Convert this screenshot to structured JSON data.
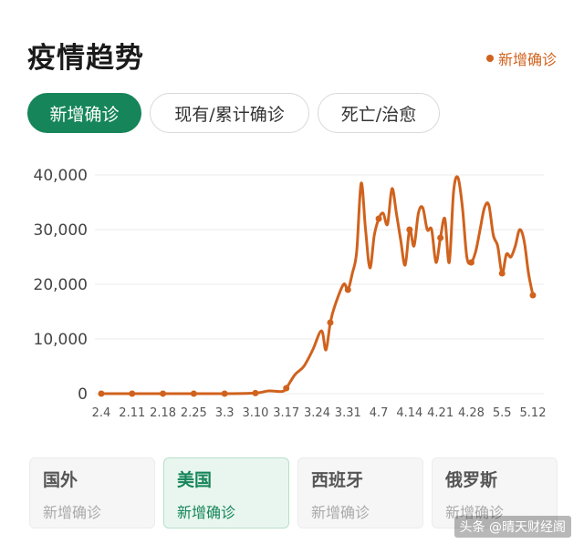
{
  "header": {
    "title": "疫情趋势",
    "legend_label": "新增确诊"
  },
  "tabs": [
    {
      "label": "新增确诊",
      "active": true
    },
    {
      "label": "现有/累计确诊",
      "active": false
    },
    {
      "label": "死亡/治愈",
      "active": false
    }
  ],
  "cards": [
    {
      "name": "国外",
      "sub": "新增确诊",
      "active": false
    },
    {
      "name": "美国",
      "sub": "新增确诊",
      "active": true
    },
    {
      "name": "西班牙",
      "sub": "新增确诊",
      "active": false
    },
    {
      "name": "俄罗斯",
      "sub": "新增确诊",
      "active": false
    }
  ],
  "watermark": "头条 @晴天财经阁",
  "colors": {
    "accent": "#16855a",
    "series": "#d0621d",
    "grid": "#ebebeb"
  },
  "chart_data": {
    "type": "line",
    "title": "",
    "xlabel": "",
    "ylabel": "",
    "ylim": [
      0,
      40000
    ],
    "yticks": [
      "0",
      "10,000",
      "20,000",
      "30,000",
      "40,000"
    ],
    "ytick_values": [
      0,
      10000,
      20000,
      30000,
      40000
    ],
    "x_tick_labels": [
      "2.4",
      "2.11",
      "2.18",
      "2.25",
      "3.3",
      "3.10",
      "3.17",
      "3.24",
      "3.31",
      "4.7",
      "4.14",
      "4.21",
      "4.28",
      "5.5",
      "5.12"
    ],
    "x_tick_index": [
      0,
      7,
      14,
      21,
      28,
      35,
      42,
      49,
      56,
      63,
      70,
      77,
      84,
      91,
      98
    ],
    "grid": true,
    "series": [
      {
        "name": "新增确诊",
        "x": [
          0,
          7,
          14,
          21,
          28,
          35,
          38,
          41,
          42,
          44,
          46,
          48,
          50,
          51,
          52,
          53,
          55,
          56,
          57,
          58,
          59,
          60,
          61,
          62,
          63,
          64,
          65,
          66,
          67,
          68,
          69,
          70,
          71,
          72,
          73,
          74,
          75,
          76,
          77,
          78,
          79,
          80,
          81,
          82,
          83,
          84,
          85,
          86,
          87,
          88,
          89,
          90,
          91,
          92,
          93,
          94,
          95,
          96,
          97,
          98
        ],
        "y": [
          0,
          0,
          0,
          0,
          0,
          100,
          500,
          400,
          1000,
          3500,
          5000,
          8000,
          11500,
          8000,
          13000,
          16000,
          20000,
          19000,
          22000,
          26000,
          38500,
          30000,
          23000,
          29000,
          32000,
          33000,
          31000,
          37500,
          33000,
          28000,
          23500,
          30000,
          27000,
          33000,
          34000,
          30000,
          30000,
          24000,
          28500,
          32000,
          24000,
          37000,
          39500,
          34000,
          25000,
          24000,
          26000,
          30000,
          34000,
          34500,
          29000,
          27000,
          22000,
          25500,
          25000,
          27000,
          30000,
          28000,
          22000,
          18000
        ]
      }
    ],
    "markers_x": [
      0,
      7,
      14,
      21,
      28,
      35,
      42,
      52,
      56,
      63,
      70,
      77,
      84,
      91,
      98
    ]
  }
}
